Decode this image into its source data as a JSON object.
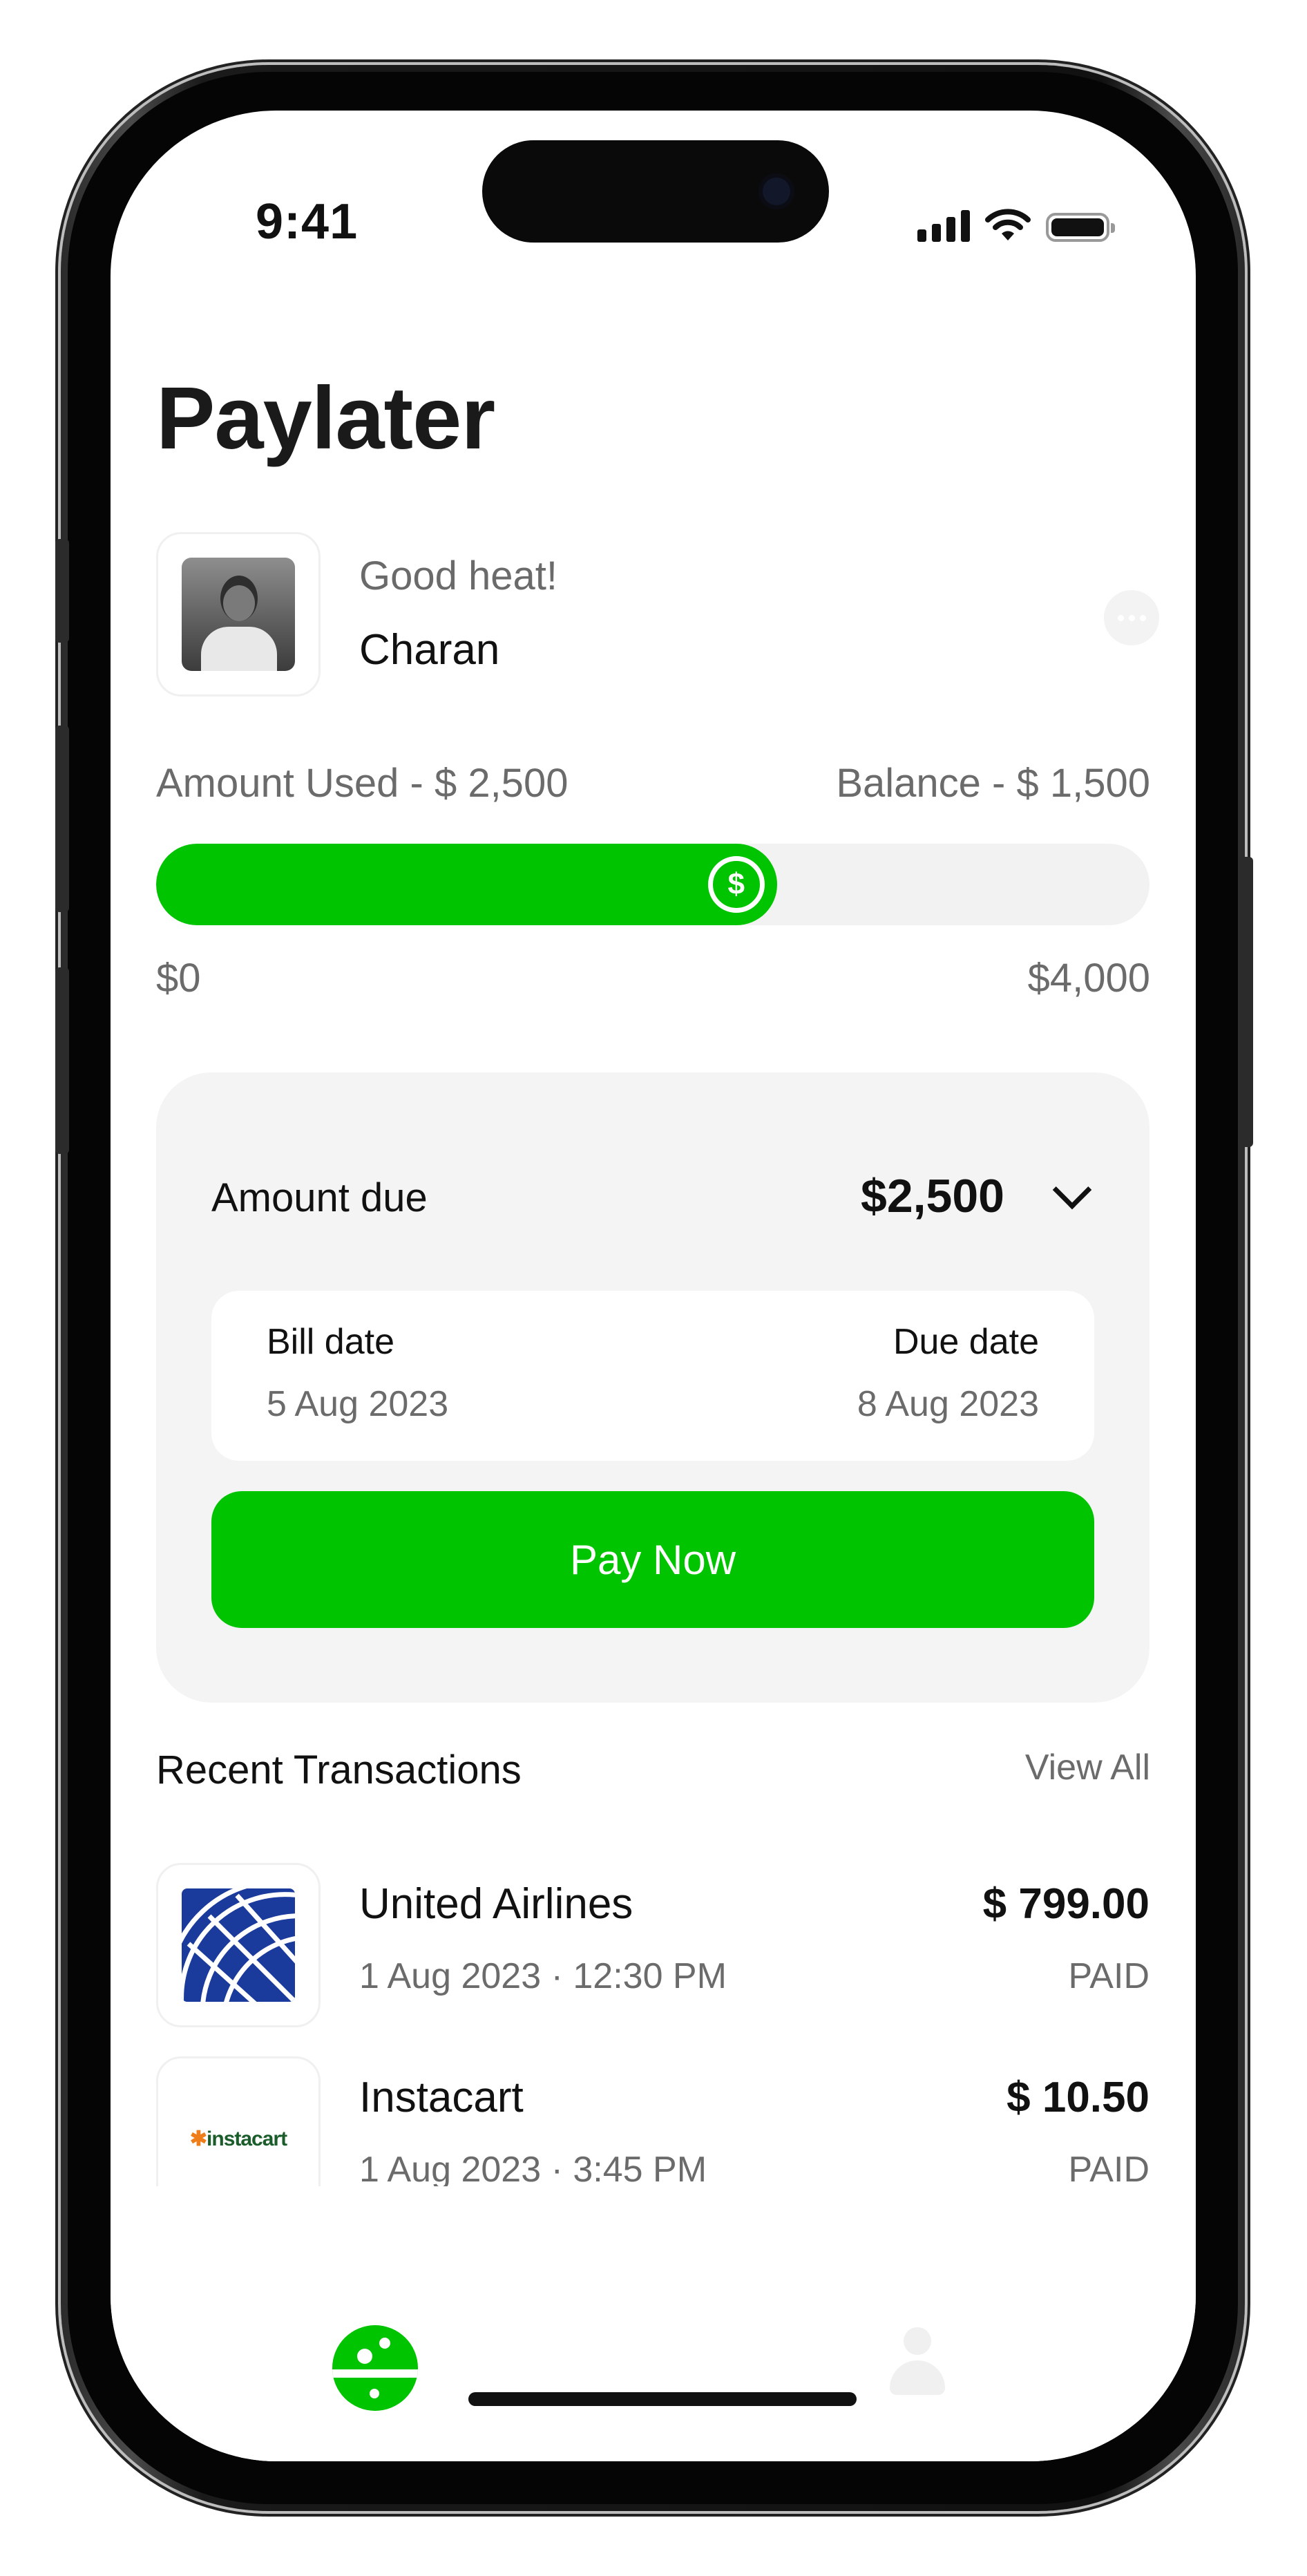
{
  "status_bar": {
    "time": "9:41"
  },
  "header": {
    "title": "Paylater"
  },
  "profile": {
    "greeting": "Good heat!",
    "name": "Charan"
  },
  "credit": {
    "used_label": "Amount Used - $ 2,500",
    "balance_label": "Balance - $ 1,500",
    "min_label": "$0",
    "max_label": "$4,000",
    "used_fraction": 0.625,
    "thumb_symbol": "$",
    "accent_color": "#00c400"
  },
  "due": {
    "label": "Amount due",
    "amount": "$2,500",
    "bill_date_label": "Bill date",
    "bill_date_value": "5 Aug 2023",
    "due_date_label": "Due date",
    "due_date_value": "8 Aug 2023",
    "pay_label": "Pay Now"
  },
  "transactions": {
    "title": "Recent Transactions",
    "view_all": "View All",
    "items": [
      {
        "name": "United Airlines",
        "date": "1 Aug 2023 · 12:30 PM",
        "amount": "$ 799.00",
        "status": "PAID",
        "icon": "united-airlines-logo"
      },
      {
        "name": "Instacart",
        "date": "1 Aug 2023 · 3:45 PM",
        "amount": "$ 10.50",
        "status": "PAID",
        "icon": "instacart-logo",
        "logo_text": "instacart"
      }
    ]
  },
  "tab_bar": {
    "items": [
      "home-icon",
      "profile-icon"
    ]
  }
}
